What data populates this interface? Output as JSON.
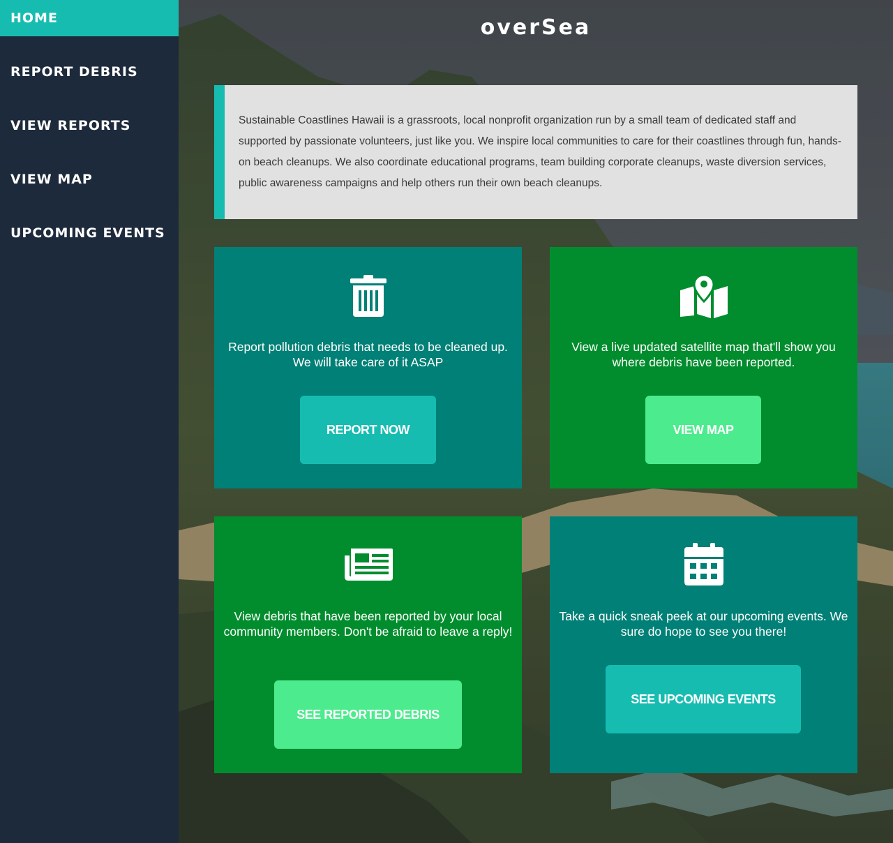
{
  "sidebar": {
    "items": [
      {
        "label": "HOME",
        "active": true
      },
      {
        "label": "REPORT DEBRIS",
        "active": false
      },
      {
        "label": "VIEW REPORTS",
        "active": false
      },
      {
        "label": "VIEW MAP",
        "active": false
      },
      {
        "label": "UPCOMING EVENTS",
        "active": false
      }
    ]
  },
  "header": {
    "brand": "overSea"
  },
  "about": {
    "text": "Sustainable Coastlines Hawaii is a grassroots, local nonprofit organization run by a small team of dedicated staff and supported by passionate volunteers, just like you. We inspire local communities to care for their coastlines through fun, hands-on beach cleanups. We also coordinate educational programs, team building corporate cleanups, waste diversion services, public awareness campaigns and help others run their own beach cleanups."
  },
  "cards": {
    "report": {
      "icon": "trash-icon",
      "description": "Report pollution debris that needs to be cleaned up. We will take care of it ASAP",
      "button": "REPORT NOW"
    },
    "map": {
      "icon": "map-marker-icon",
      "description": "View a live updated satellite map that'll show you where debris have been reported.",
      "button": "VIEW MAP"
    },
    "reports": {
      "icon": "newspaper-icon",
      "description": "View debris that have been reported by your local community members. Don't be afraid to leave a reply!",
      "button": "SEE REPORTED DEBRIS"
    },
    "events": {
      "icon": "calendar-icon",
      "description": "Take a quick sneak peek at our upcoming events. We sure do hope to see you there!",
      "button": "SEE UPCOMING EVENTS"
    }
  },
  "colors": {
    "sidebar": "#1d2a3b",
    "accent": "#17bcb1",
    "card_teal": "#008076",
    "card_green": "#018d2d",
    "button_mint": "#4ceb8d",
    "about_bg": "#e1e1e1"
  }
}
